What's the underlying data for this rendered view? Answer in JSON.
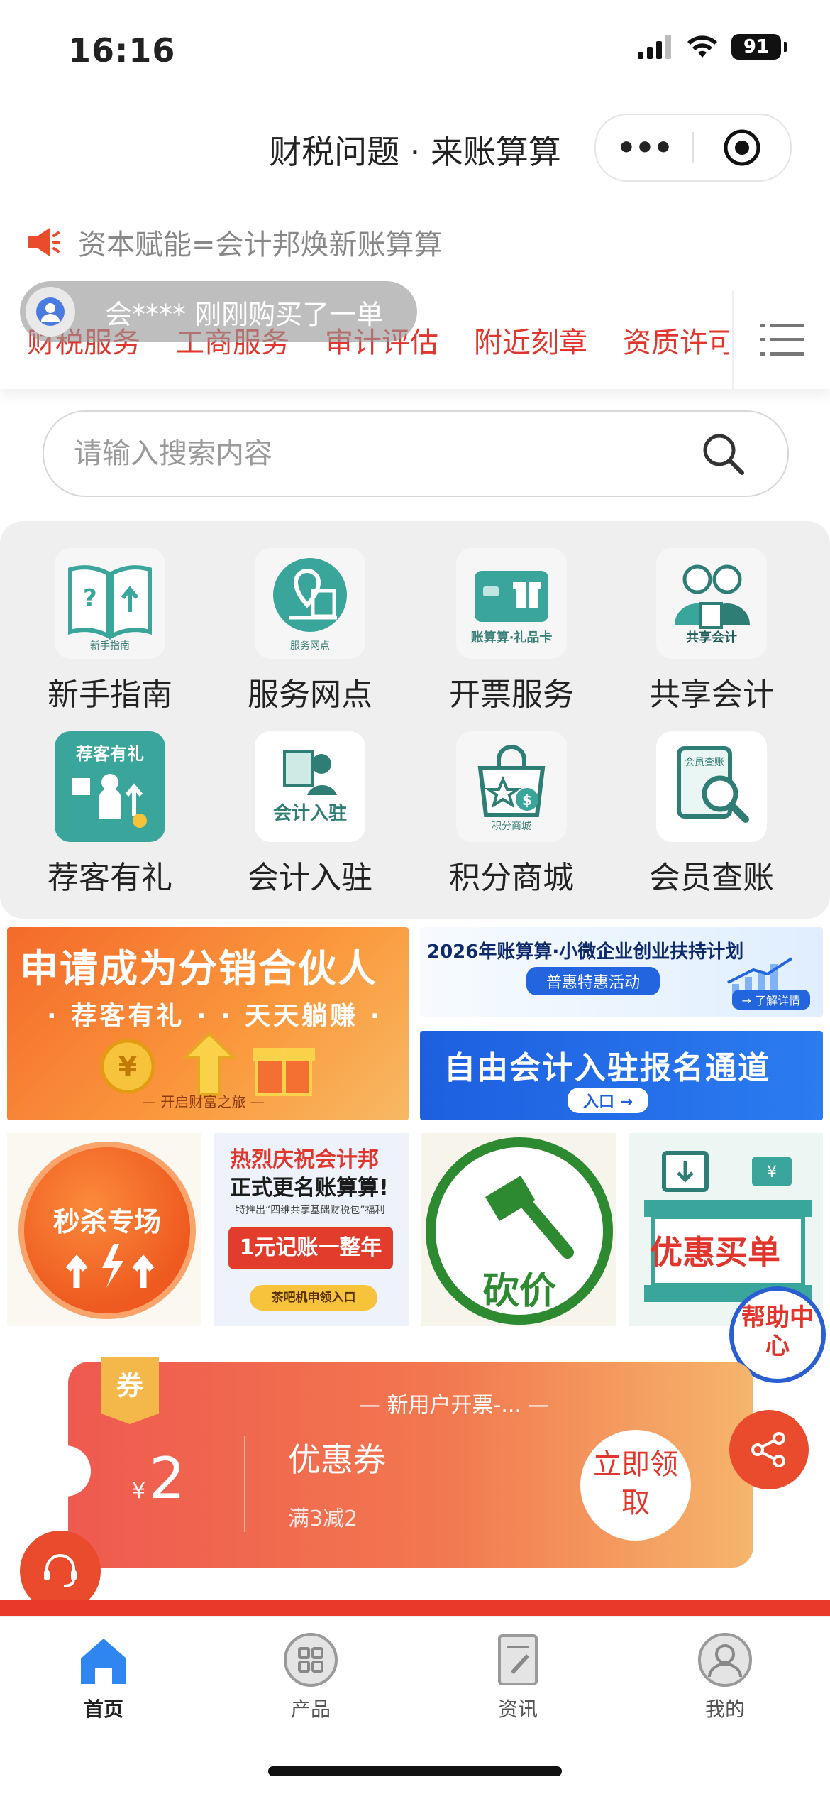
{
  "status": {
    "time": "16:16",
    "battery": "91"
  },
  "header": {
    "title": "财税问题 · 来账算算"
  },
  "notice": {
    "text": "资本赋能=会计邦焕新账算算"
  },
  "toast": {
    "text": "会**** 刚刚购买了一单"
  },
  "tabs": [
    "财税服务",
    "工商服务",
    "审计评估",
    "附近刻章",
    "资质许可"
  ],
  "search": {
    "placeholder": "请输入搜索内容"
  },
  "grid": [
    {
      "label": "新手指南",
      "icon_caption": "新手指南",
      "icon": "book-icon"
    },
    {
      "label": "服务网点",
      "icon_caption": "服务网点",
      "icon": "location-building-icon"
    },
    {
      "label": "开票服务",
      "icon_caption": "账算算·礼品卡",
      "icon": "gift-card-icon"
    },
    {
      "label": "共享会计",
      "icon_caption": "共享会计",
      "icon": "accountants-icon"
    },
    {
      "label": "荐客有礼",
      "icon_caption": "荐客有礼",
      "icon": "referral-gift-icon"
    },
    {
      "label": "会计入驻",
      "icon_caption": "会计入驻",
      "icon": "accountant-join-icon"
    },
    {
      "label": "积分商城",
      "icon_caption": "积分商城",
      "icon": "points-bag-icon"
    },
    {
      "label": "会员查账",
      "icon_caption": "会员查账",
      "icon": "search-ledger-icon"
    }
  ],
  "banners": {
    "partner": {
      "title": "申请成为分销合伙人",
      "subtitle": "· 荐客有礼 · · 天天躺赚 ·",
      "tag": "— 开启财富之旅 —"
    },
    "plan": {
      "title": "2026年账算算·小微企业创业扶持计划",
      "pill": "普惠特惠活动",
      "more": "→ 了解详情"
    },
    "join": {
      "title": "自由会计入驻报名通道",
      "pill": "入口 →"
    },
    "seckill": {
      "text": "秒杀专场"
    },
    "rename": {
      "line1": "热烈庆祝会计邦",
      "line2": "正式更名账算算!",
      "line3": "特推出“四维共享基础财税包”福利",
      "pill": "1元记账一整年",
      "button": "茶吧机申领入口"
    },
    "bargain": {
      "text": "砍价"
    },
    "discount": {
      "text": "优惠买单"
    }
  },
  "help": {
    "text": "帮助中心"
  },
  "coupon": {
    "badge": "券",
    "heading": "— 新用户开票-... —",
    "currency": "¥",
    "amount": "2",
    "name": "优惠券",
    "condition": "满3减2",
    "button": "立即领取"
  },
  "nav": [
    {
      "label": "首页",
      "icon": "home-icon",
      "active": true
    },
    {
      "label": "产品",
      "icon": "grid-icon",
      "active": false
    },
    {
      "label": "资讯",
      "icon": "news-icon",
      "active": false
    },
    {
      "label": "我的",
      "icon": "user-icon",
      "active": false
    }
  ],
  "colors": {
    "accent": "#e0362d",
    "teal": "#3aa59a",
    "fab": "#ea4b2c",
    "blue": "#2364df"
  }
}
